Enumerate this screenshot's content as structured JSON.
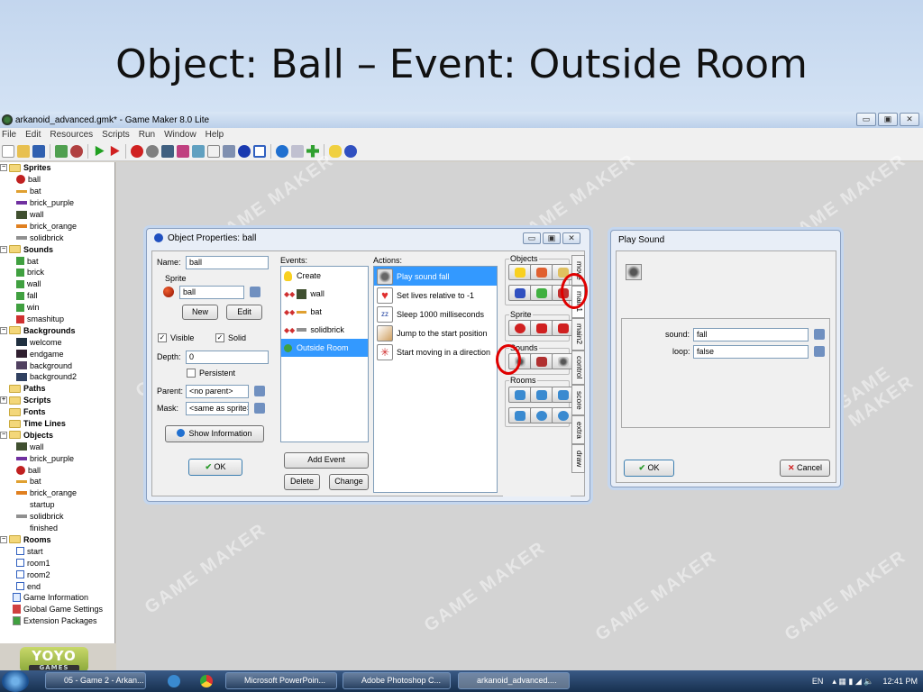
{
  "slide": {
    "title": "Object: Ball – Event: Outside Room"
  },
  "window": {
    "title": "arkanoid_advanced.gmk* - Game Maker 8.0 Lite",
    "controls": [
      "▭",
      "▣",
      "✕"
    ]
  },
  "menu": [
    "File",
    "Edit",
    "Resources",
    "Scripts",
    "Run",
    "Window",
    "Help"
  ],
  "tree": {
    "sprites": {
      "label": "Sprites",
      "items": [
        "ball",
        "bat",
        "brick_purple",
        "wall",
        "brick_orange",
        "solidbrick"
      ]
    },
    "sounds": {
      "label": "Sounds",
      "items": [
        "bat",
        "brick",
        "wall",
        "fall",
        "win",
        "smashitup"
      ]
    },
    "backgrounds": {
      "label": "Backgrounds",
      "items": [
        "welcome",
        "endgame",
        "background",
        "background2"
      ]
    },
    "paths": "Paths",
    "scripts": "Scripts",
    "fonts": "Fonts",
    "timelines": "Time Lines",
    "objects": {
      "label": "Objects",
      "items": [
        "wall",
        "brick_purple",
        "ball",
        "bat",
        "brick_orange",
        "startup",
        "solidbrick",
        "finished"
      ]
    },
    "rooms": {
      "label": "Rooms",
      "items": [
        "start",
        "room1",
        "room2",
        "end"
      ]
    },
    "extras": [
      "Game Information",
      "Global Game Settings",
      "Extension Packages"
    ]
  },
  "logo": {
    "text": "YOYO",
    "sub": "GAMES"
  },
  "watermark": "GAME MAKER",
  "object_dialog": {
    "title": "Object Properties: ball",
    "name_label": "Name:",
    "name_value": "ball",
    "sprite_label": "Sprite",
    "sprite_value": "ball",
    "new_label": "New",
    "edit_label": "Edit",
    "visible_label": "Visible",
    "solid_label": "Solid",
    "depth_label": "Depth:",
    "depth_value": "0",
    "persistent_label": "Persistent",
    "parent_label": "Parent:",
    "parent_value": "<no parent>",
    "mask_label": "Mask:",
    "mask_value": "<same as sprite>",
    "show_info_label": "Show Information",
    "ok_label": "OK",
    "events_label": "Events:",
    "events": [
      "Create",
      "wall",
      "bat",
      "solidbrick",
      "Outside Room"
    ],
    "add_event_label": "Add Event",
    "delete_label": "Delete",
    "change_label": "Change",
    "actions_label": "Actions:",
    "actions": [
      "Play sound fall",
      "Set lives relative to -1",
      "Sleep 1000 milliseconds",
      "Jump to the start position",
      "Start moving in a direction"
    ],
    "palette": {
      "objects": "Objects",
      "sprite": "Sprite",
      "sounds": "Sounds",
      "rooms": "Rooms"
    },
    "tabs": [
      "move",
      "main1",
      "main2",
      "control",
      "score",
      "extra",
      "draw"
    ]
  },
  "sound_dialog": {
    "title": "Play Sound",
    "sound_label": "sound:",
    "sound_value": "fall",
    "loop_label": "loop:",
    "loop_value": "false",
    "ok_label": "OK",
    "cancel_label": "Cancel"
  },
  "taskbar": {
    "tasks": [
      "05 - Game 2 - Arkan...",
      "Microsoft PowerPoin...",
      "Adobe Photoshop C...",
      "arkanoid_advanced...."
    ],
    "lang": "EN",
    "clock": "12:41 PM"
  }
}
